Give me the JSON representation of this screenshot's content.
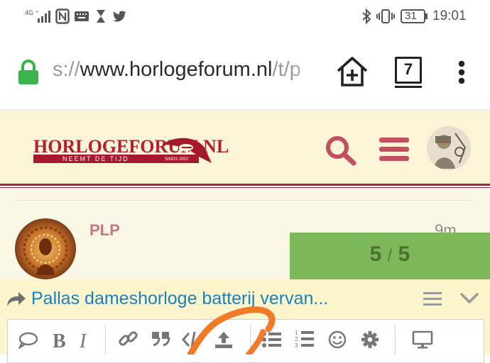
{
  "status_bar": {
    "network": "4G",
    "battery": "31",
    "time": "19:01"
  },
  "browser": {
    "url_scheme": "s://",
    "url_host": "www.horlogeforum.nl",
    "url_path": "/t/p",
    "tab_count": "7"
  },
  "site": {
    "logo_title": "HORLOGEFORUM.NL",
    "logo_subtitle": "NEEMT DE TIJD",
    "logo_since": "SINDS 2002"
  },
  "post": {
    "author": "PLP",
    "time": "9m"
  },
  "progress": {
    "current": "5",
    "separator": "/",
    "total": "5"
  },
  "composer": {
    "reply_title": "Pallas dameshorloge batterij vervan..."
  },
  "colors": {
    "brand": "#a6182e",
    "header_bg": "#fbf4d6",
    "composer_bg": "#fcf5cc",
    "progress_bg": "#7cb85a",
    "link_blue": "#1b80c0",
    "secure_lock": "#39b54a",
    "annotation_orange": "#f07a28"
  }
}
